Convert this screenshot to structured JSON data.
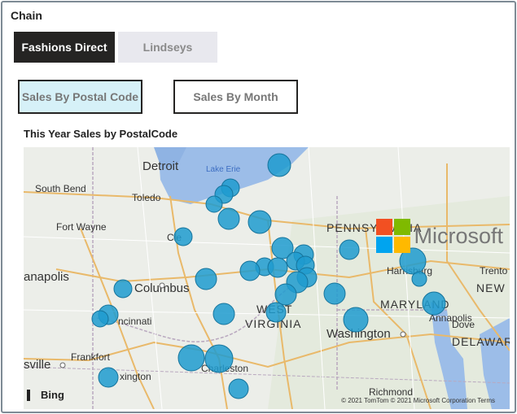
{
  "chain": {
    "label": "Chain",
    "options": [
      {
        "label": "Fashions Direct",
        "selected": true
      },
      {
        "label": "Lindseys",
        "selected": false
      }
    ]
  },
  "tabs": [
    {
      "label": "Sales By Postal Code",
      "active": true
    },
    {
      "label": "Sales By Month",
      "active": false
    }
  ],
  "map": {
    "title": "This Year Sales by PostalCode",
    "places": {
      "detroit": "Detroit",
      "lake_erie": "Lake Erie",
      "south_bend": "South Bend",
      "toledo": "Toledo",
      "fort_wayne": "Fort Wayne",
      "indianapolis": "anapolis",
      "columbus": "Columbus",
      "cincinnati": "ncinnati",
      "frankfort": "Frankfort",
      "louisville": "sville",
      "lexington": "xington",
      "cleveland": "Cle",
      "pennsylvania": "PENNSYLVANIA",
      "harrisburg": "Harrisburg",
      "trenton": "Trento",
      "new_jersey": "NEW",
      "west_virginia_1": "WEST",
      "west_virginia_2": "VIRGINIA",
      "maryland": "MARYLAND",
      "annapolis": "Annapolis",
      "dover": "Dove",
      "delaware": "DELAWAR",
      "washington": "Washington",
      "charleston": "Charleston",
      "richmond": "Richmond"
    },
    "brand": "Microsoft",
    "bing": "Bing",
    "attribution": "© 2021 TomTom © 2021 Microsoft Corporation Terms",
    "bubble_color": "#1f9bcf"
  }
}
